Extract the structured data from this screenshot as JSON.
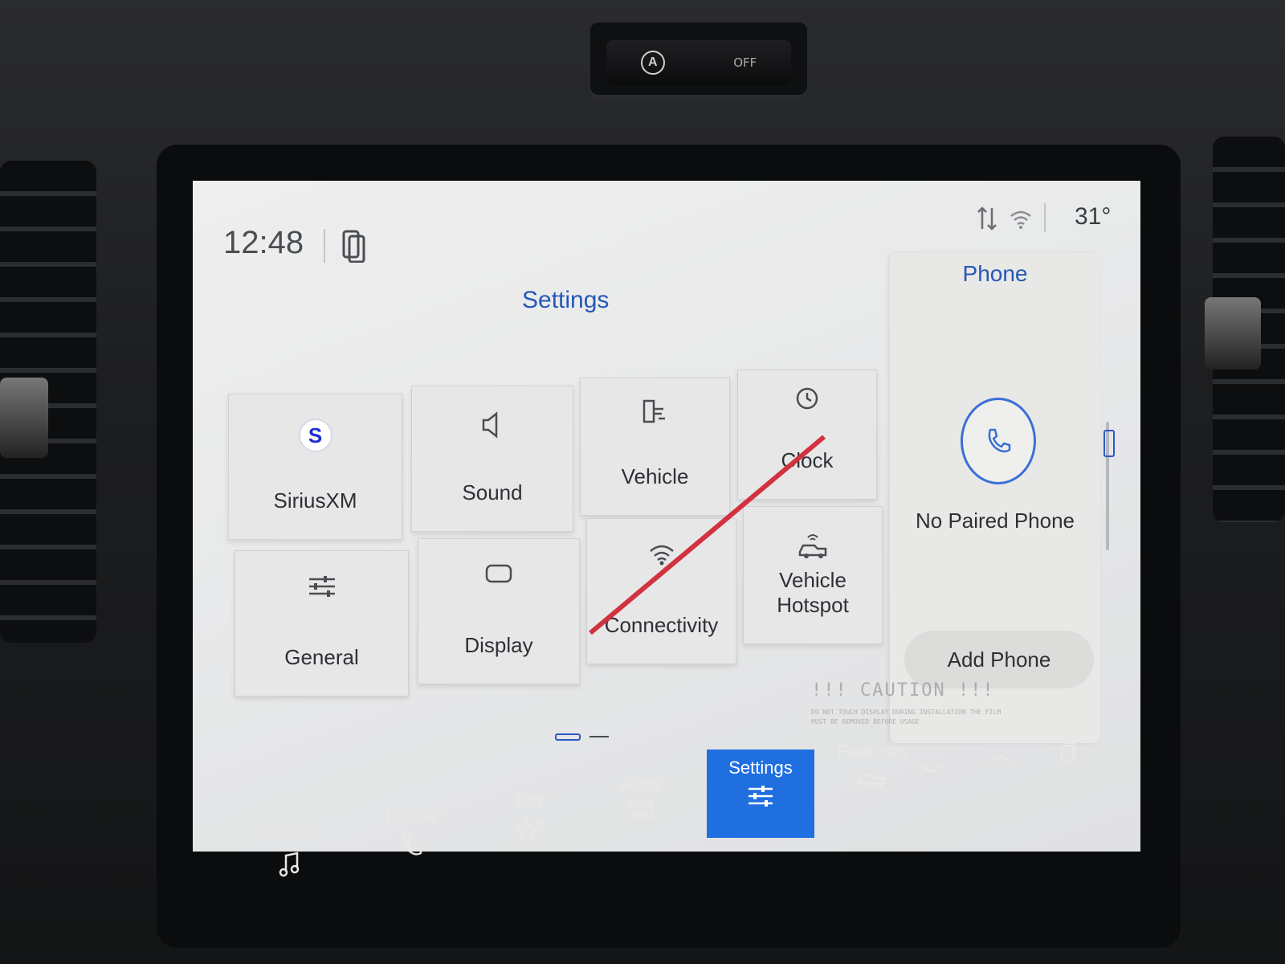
{
  "hazard": {
    "auto_label": "A",
    "off_label": "OFF"
  },
  "status": {
    "time": "12:48",
    "temperature": "31°"
  },
  "settings": {
    "title": "Settings",
    "tiles": [
      {
        "label": "SiriusXM",
        "icon": "siriusxm-icon"
      },
      {
        "label": "Sound",
        "icon": "speaker-icon"
      },
      {
        "label": "Vehicle",
        "icon": "vehicle-icon"
      },
      {
        "label": "Clock",
        "icon": "clock-icon"
      },
      {
        "label": "General",
        "icon": "sliders-icon"
      },
      {
        "label": "Display",
        "icon": "display-icon"
      },
      {
        "label": "Connectivity",
        "icon": "wifi-icon"
      },
      {
        "label": "Vehicle Hotspot",
        "icon": "hotspot-icon"
      }
    ],
    "sirius_badge": "S"
  },
  "sticker": {
    "caution": "!!! CAUTION !!!",
    "small_text": "DO NOT TOUCH DISPLAY DURING INSTALLATION THE FILM MUST BE REMOVED BEFORE USAGE"
  },
  "phone_panel": {
    "title": "Phone",
    "status": "No Paired Phone",
    "add_button": "Add Phone"
  },
  "nav": {
    "items": [
      {
        "label": "Audio",
        "icon": "music-note-icon"
      },
      {
        "label": "Phone",
        "icon": "phone-icon"
      },
      {
        "label": "Fav",
        "icon": "star-plus-icon"
      },
      {
        "label": "Apps",
        "icon": "grid-icon"
      },
      {
        "label": "Settings",
        "icon": "sliders-icon"
      },
      {
        "label": "Features",
        "icon": "truck-icon"
      }
    ],
    "active": "Settings"
  },
  "colors": {
    "accent": "#2457b8",
    "active_nav": "#1f6fe0",
    "caution_line": "#d2323f"
  }
}
